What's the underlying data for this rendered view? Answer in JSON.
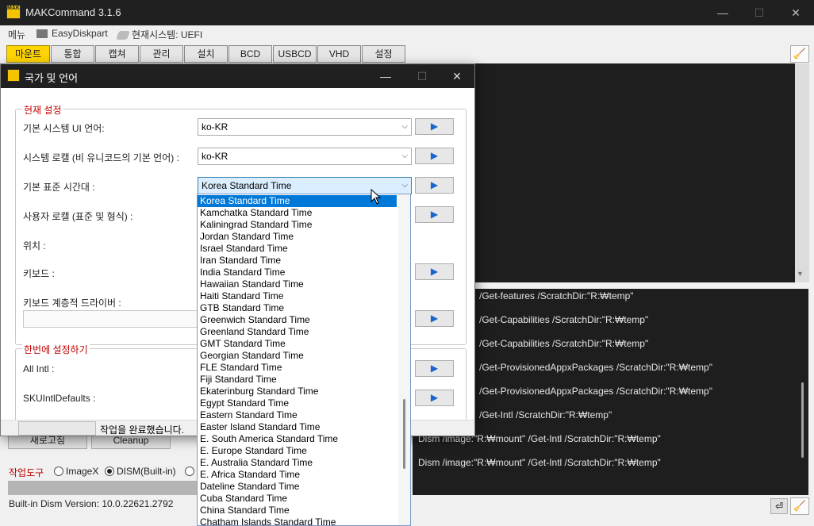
{
  "app": {
    "title": "MAKCommand 3.1.6",
    "icon_text": "MAK"
  },
  "menubar": {
    "menu": "메뉴",
    "easydiskpart": "EasyDiskpart",
    "current_system": "현재시스템: UEFI"
  },
  "tabs": [
    "마운트",
    "통합",
    "캡쳐",
    "관리",
    "설치",
    "BCD",
    "USBCD",
    "VHD",
    "설정"
  ],
  "active_tab": "마운트",
  "console": {
    "lines": [
      "/Get-features /ScratchDir:\"R:₩temp\"",
      "/Get-Capabilities /ScratchDir:\"R:₩temp\"",
      "/Get-Capabilities /ScratchDir:\"R:₩temp\"",
      "/Get-ProvisionedAppxPackages /ScratchDir:\"R:₩temp\"",
      "/Get-ProvisionedAppxPackages /ScratchDir:\"R:₩temp\"",
      "/Get-Intl /ScratchDir:\"R:₩temp\"",
      "Dism /image:\"R:₩mount\" /Get-Intl /ScratchDir:\"R:₩temp\"",
      "Dism /image:\"R:₩mount\" /Get-Intl /ScratchDir:\"R:₩temp\""
    ]
  },
  "bottom": {
    "reset_button": "새로고침",
    "cleanup_button": "Cleanup",
    "tool_label": "작업도구",
    "radio_imagex": "ImageX",
    "radio_dism": "DISM(Built-in)",
    "selected_tool": "DISM(Built-in)",
    "version": "Built-in Dism Version: 10.0.22621.2792"
  },
  "dialog": {
    "title": "국가 및 언어",
    "group_current": "현재 설정",
    "group_all": "한번에 설정하기",
    "fields": {
      "ui_language": "기본 시스템 UI 언어:",
      "system_locale": "시스템 로캘 (비 유니코드의 기본 언어) :",
      "timezone": "기본 표준 시간대 :",
      "user_locale": "사용자 로캘 (표준 및 형식) :",
      "location": "위치 :",
      "keyboard": "키보드 :",
      "keyboard_driver": "키보드 계층적 드라이버 :",
      "all_intl": "All Intl :",
      "sku_defaults": "SKUIntlDefaults :"
    },
    "values": {
      "ui_language": "ko-KR",
      "system_locale": "ko-KR",
      "timezone": "Korea Standard Time"
    },
    "go_glyph": "▶",
    "status_text": "작업을 완료했습니다."
  },
  "timezone_options": [
    "Korea Standard Time",
    "Kamchatka Standard Time",
    "Kaliningrad Standard Time",
    "Jordan Standard Time",
    "Israel Standard Time",
    "Iran Standard Time",
    "India Standard Time",
    "Hawaiian Standard Time",
    "Haiti Standard Time",
    "GTB Standard Time",
    "Greenwich Standard Time",
    "Greenland Standard Time",
    "GMT Standard Time",
    "Georgian Standard Time",
    "FLE Standard Time",
    "Fiji Standard Time",
    "Ekaterinburg Standard Time",
    "Egypt Standard Time",
    "Eastern Standard Time",
    "Easter Island Standard Time",
    "E. South America Standard Time",
    "E. Europe Standard Time",
    "E. Australia Standard Time",
    "E. Africa Standard Time",
    "Dateline Standard Time",
    "Cuba Standard Time",
    "China Standard Time",
    "Chatham Islands Standard Time"
  ],
  "selected_timezone": "Korea Standard Time",
  "icons": {
    "minimize": "—",
    "maximize": "☐",
    "close": "✕",
    "chevron": "⌵",
    "broom": "🧹",
    "enter": "⏎",
    "scroll_down": "▼"
  }
}
